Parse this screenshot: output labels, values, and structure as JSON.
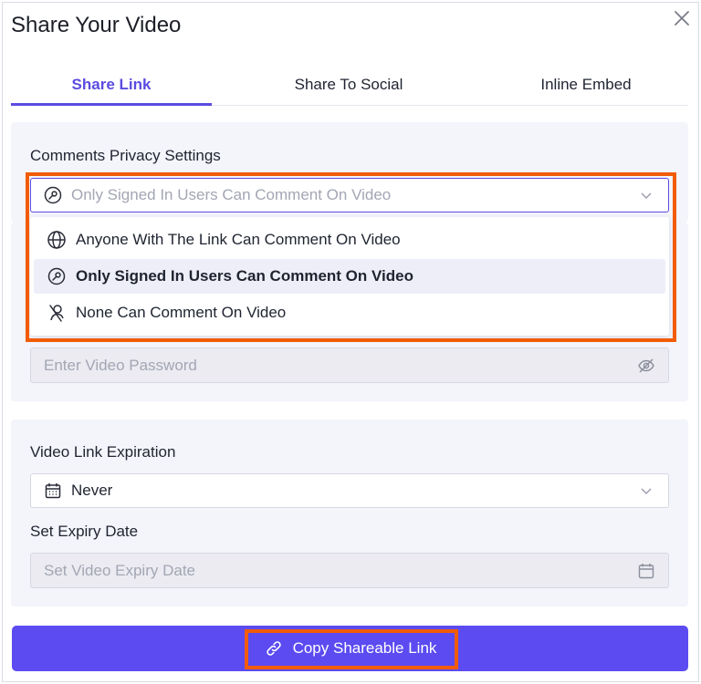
{
  "dialog": {
    "title": "Share Your Video",
    "close_icon": "close-icon"
  },
  "tabs": [
    {
      "label": "Share Link",
      "active": true
    },
    {
      "label": "Share To Social",
      "active": false
    },
    {
      "label": "Inline Embed",
      "active": false
    }
  ],
  "comments": {
    "label": "Comments Privacy Settings",
    "selected_value": "Only Signed In Users Can Comment On Video",
    "selected_icon": "key-icon",
    "options": [
      {
        "label": "Anyone With The Link Can Comment On Video",
        "icon": "globe-icon",
        "selected": false
      },
      {
        "label": "Only Signed In Users Can Comment On Video",
        "icon": "key-icon",
        "selected": true
      },
      {
        "label": "None Can Comment On Video",
        "icon": "user-slash-icon",
        "selected": false
      }
    ]
  },
  "password": {
    "placeholder": "Enter Video Password",
    "toggle_icon": "eye-slash-icon"
  },
  "expiration": {
    "label": "Video Link Expiration",
    "value": "Never",
    "icon": "calendar-icon"
  },
  "expiry_date": {
    "label": "Set Expiry Date",
    "placeholder": "Set Video Expiry Date",
    "icon": "calendar-icon"
  },
  "copy_button": {
    "label": "Copy Shareable Link",
    "icon": "link-icon"
  },
  "colors": {
    "accent": "#5b4be0",
    "button": "#5b4bf0",
    "highlight": "#f25c05",
    "card_bg": "#f4f4fb"
  }
}
